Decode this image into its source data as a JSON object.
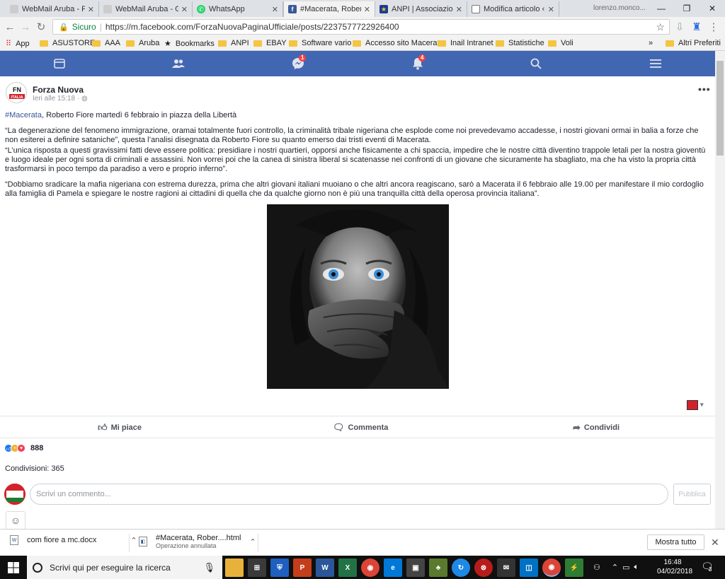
{
  "browser": {
    "tabs": [
      {
        "label": "WebMail Aruba - P",
        "icon": "globe-icon",
        "color": "#cccccc"
      },
      {
        "label": "WebMail Aruba - G",
        "icon": "globe-icon",
        "color": "#cccccc"
      },
      {
        "label": "WhatsApp",
        "icon": "whatsapp-icon",
        "color": "#25d366"
      },
      {
        "label": "#Macerata, Robert",
        "icon": "facebook-icon",
        "color": "#3b5998",
        "active": true
      },
      {
        "label": "ANPI | Associazion",
        "icon": "star-icon",
        "color": "#e6b800"
      },
      {
        "label": "Modifica articolo ‹",
        "icon": "page-icon",
        "color": "#777777"
      }
    ],
    "profile": "lorenzo.monco...",
    "address": {
      "secure_label": "Sicuro",
      "url": "https://m.facebook.com/ForzaNuovaPaginaUfficiale/posts/2237577722926400"
    },
    "bookmarks": [
      {
        "label": "App",
        "icon": "apps-grid-icon"
      },
      {
        "label": "ASUSTORE",
        "icon": "folder-icon"
      },
      {
        "label": "AAA",
        "icon": "folder-icon"
      },
      {
        "label": "Aruba",
        "icon": "folder-icon"
      },
      {
        "label": "Bookmarks",
        "icon": "star-icon"
      },
      {
        "label": "ANPI",
        "icon": "folder-icon"
      },
      {
        "label": "EBAY",
        "icon": "folder-icon"
      },
      {
        "label": "Software vario",
        "icon": "folder-icon"
      },
      {
        "label": "Accesso sito Macerat",
        "icon": "folder-icon"
      },
      {
        "label": "Inail Intranet",
        "icon": "folder-icon"
      },
      {
        "label": "Statistiche",
        "icon": "folder-icon"
      },
      {
        "label": "Voli",
        "icon": "folder-icon"
      }
    ],
    "bookmarks_overflow": "»",
    "bookmarks_other": "Altri Preferiti"
  },
  "facebook": {
    "brand_color": "#4267b2",
    "nav": [
      {
        "icon": "news-feed-icon"
      },
      {
        "icon": "friends-icon"
      },
      {
        "icon": "messenger-icon",
        "badge": "1"
      },
      {
        "icon": "notifications-icon",
        "badge": "4"
      },
      {
        "icon": "search-icon"
      },
      {
        "icon": "menu-icon"
      }
    ],
    "post": {
      "author": "Forza Nuova",
      "avatar_text": "FN ITALIA",
      "time": "Ieri alle 15:18 ·",
      "hashtag": "#Macerata",
      "headline": ", Roberto Fiore martedì 6 febbraio in piazza della Libertà",
      "paragraph1": "“La degenerazione del fenomeno immigrazione, oramai totalmente fuori controllo, la criminalità tribale nigeriana che esplode come noi prevedevamo accadesse, i nostri giovani ormai in balia a forze che non esiterei a definire sataniche”, questa l’analisi disegnata da Roberto Fiore su quanto emerso dai tristi eventi di Macerata.",
      "paragraph2": "“L’unica risposta a questi gravissimi fatti deve essere politica: presidiare i nostri quartieri, opporsi anche fisicamente a chi spaccia, impedire che le nostre città diventino trappole letali per la nostra gioventù e luogo ideale per ogni sorta di criminali e assassini. Non vorrei poi che la canea di sinistra liberal si scatenasse nei confronti di un giovane che sicuramente ha sbagliato, ma che ha visto la propria città trasformarsi in poco tempo da paradiso a vero e proprio inferno”.",
      "paragraph3": "“Dobbiamo sradicare la mafia nigeriana con estrema durezza, prima che altri giovani italiani muoiano o che altri ancora reagiscano, sarò a Macerata il 6 febbraio alle 19.00 per manifestare il mio cordoglio alla famiglia di Pamela e spiegare le nostre ragioni ai cittadini di quella che da qualche giorno non è più una tranquilla città della operosa provincia italiana”.",
      "actions": {
        "like": "Mi piace",
        "comment": "Commenta",
        "share": "Condividi"
      },
      "reaction_count": "888",
      "shares": "Condivisioni: 365",
      "comment_placeholder": "Scrivi un commento...",
      "publish": "Pubblica"
    }
  },
  "downloads": [
    {
      "name": "com fiore a mc.docx",
      "status": "",
      "icon": "word-doc-icon"
    },
    {
      "name": "#Macerata, Rober....html",
      "status": "Operazione annullata",
      "icon": "html-file-icon"
    }
  ],
  "downloads_show_all": "Mostra tutto",
  "taskbar": {
    "search_placeholder": "Scrivi qui per eseguire la ricerca",
    "apps": [
      {
        "icon": "file-explorer-icon",
        "color": "#e8b23a",
        "text": ""
      },
      {
        "icon": "store-icon",
        "color": "#3a3a3a",
        "text": ""
      },
      {
        "icon": "shield-app-icon",
        "color": "#1f5fbf",
        "text": ""
      },
      {
        "icon": "powerpoint-icon",
        "color": "#c43e1c",
        "text": "P"
      },
      {
        "icon": "word-icon",
        "color": "#2b579a",
        "text": "W"
      },
      {
        "icon": "excel-icon",
        "color": "#217346",
        "text": "X"
      },
      {
        "icon": "chrome-icon",
        "color": "#db4437",
        "text": ""
      },
      {
        "icon": "edge-icon",
        "color": "#0078d7",
        "text": "e"
      },
      {
        "icon": "app-icon",
        "color": "#444444",
        "text": ""
      },
      {
        "icon": "tree-app-icon",
        "color": "#5a7a2e",
        "text": ""
      },
      {
        "icon": "sync-app-icon",
        "color": "#1e88e5",
        "text": ""
      },
      {
        "icon": "red-app-icon",
        "color": "#b71c1c",
        "text": ""
      },
      {
        "icon": "mail-icon",
        "color": "#333333",
        "text": ""
      },
      {
        "icon": "outlook-icon",
        "color": "#0072c6",
        "text": ""
      },
      {
        "icon": "chrome-icon",
        "color": "#db4437",
        "text": ""
      },
      {
        "icon": "vpn-app-icon",
        "color": "#2e7d32",
        "text": ""
      }
    ],
    "time": "16:48",
    "date": "04/02/2018",
    "notifications": "3"
  }
}
